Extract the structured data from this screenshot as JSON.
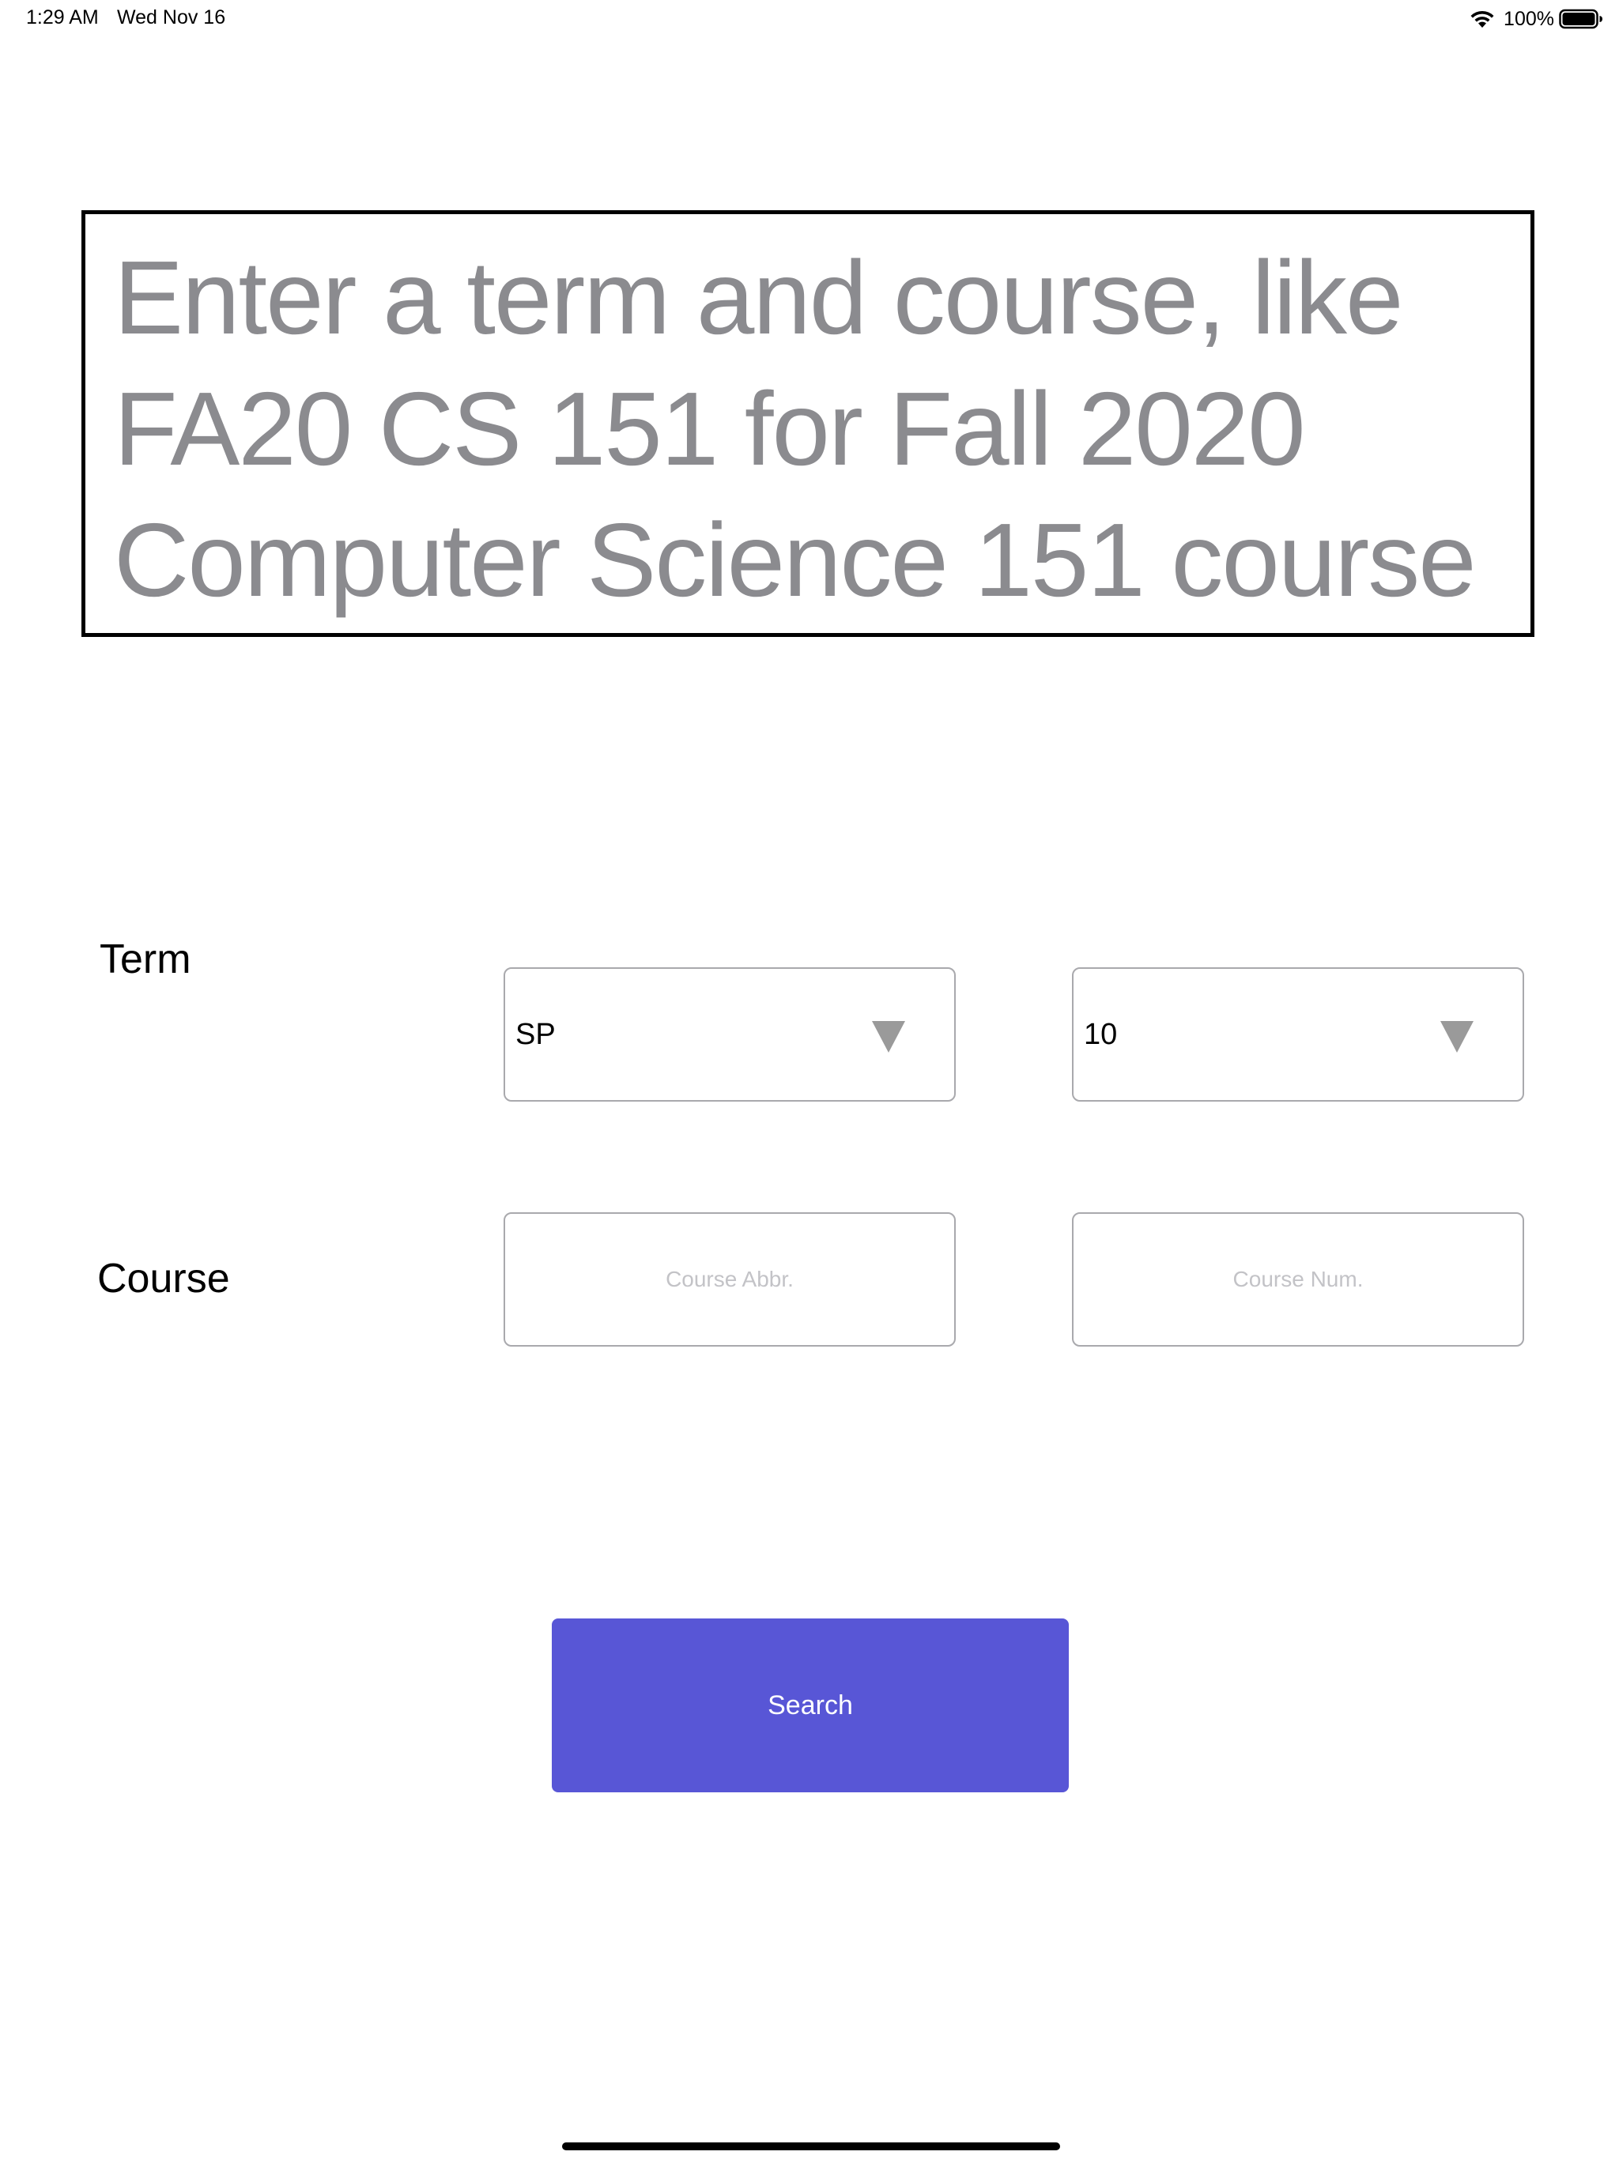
{
  "status_bar": {
    "time": "1:29 AM",
    "date": "Wed Nov 16",
    "battery_percent": "100%",
    "battery_level": 1.0,
    "icons": [
      "wifi-icon",
      "battery-icon"
    ]
  },
  "headline": {
    "lines": [
      "Enter a term and course, like",
      "FA20 CS 151 for Fall 2020",
      "Computer Science 151 course"
    ]
  },
  "form": {
    "term_label": "Term",
    "course_label": "Course",
    "term_season": {
      "value": "SP",
      "icon": "chevron-down-icon"
    },
    "term_year": {
      "value": "10",
      "icon": "chevron-down-icon"
    },
    "course_abbr": {
      "value": "",
      "placeholder": "Course Abbr."
    },
    "course_num": {
      "value": "",
      "placeholder": "Course Num."
    }
  },
  "search_button": {
    "label": "Search"
  },
  "colors": {
    "accent": "#5856d6",
    "headline_text": "#8b8b8f",
    "chevron": "#9a9a9a",
    "field_border": "#a9a9ad",
    "placeholder": "#c3c3c7"
  }
}
